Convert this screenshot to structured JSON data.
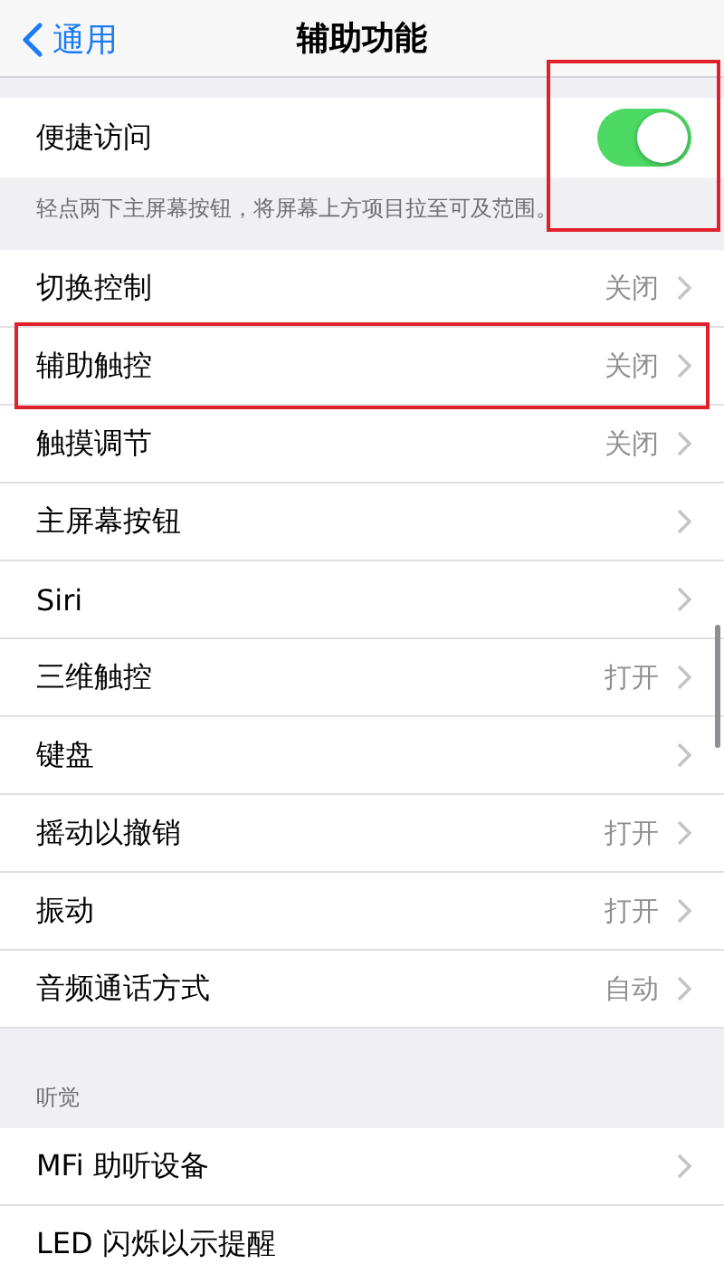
{
  "nav": {
    "back": "通用",
    "title": "辅助功能"
  },
  "toggle_row": {
    "label": "便捷访问",
    "on": true,
    "highlighted": true
  },
  "footnote": "轻点两下主屏幕按钮，将屏幕上方项目拉至可及范围。",
  "rows": [
    {
      "label": "切换控制",
      "value": "关闭",
      "highlighted": false
    },
    {
      "label": "辅助触控",
      "value": "关闭",
      "highlighted": true
    },
    {
      "label": "触摸调节",
      "value": "关闭",
      "highlighted": false
    },
    {
      "label": "主屏幕按钮",
      "value": "",
      "highlighted": false
    },
    {
      "label": "Siri",
      "value": "",
      "highlighted": false
    },
    {
      "label": "三维触控",
      "value": "打开",
      "highlighted": false
    },
    {
      "label": "键盘",
      "value": "",
      "highlighted": false
    },
    {
      "label": "摇动以撤销",
      "value": "打开",
      "highlighted": false
    },
    {
      "label": "振动",
      "value": "打开",
      "highlighted": false
    },
    {
      "label": "音频通话方式",
      "value": "自动",
      "highlighted": false
    }
  ],
  "hearing": {
    "header": "听觉",
    "rows": [
      {
        "label": "MFi 助听设备",
        "chevron": true
      },
      {
        "label": "LED 闪烁以示提醒",
        "chevron": false
      }
    ]
  }
}
